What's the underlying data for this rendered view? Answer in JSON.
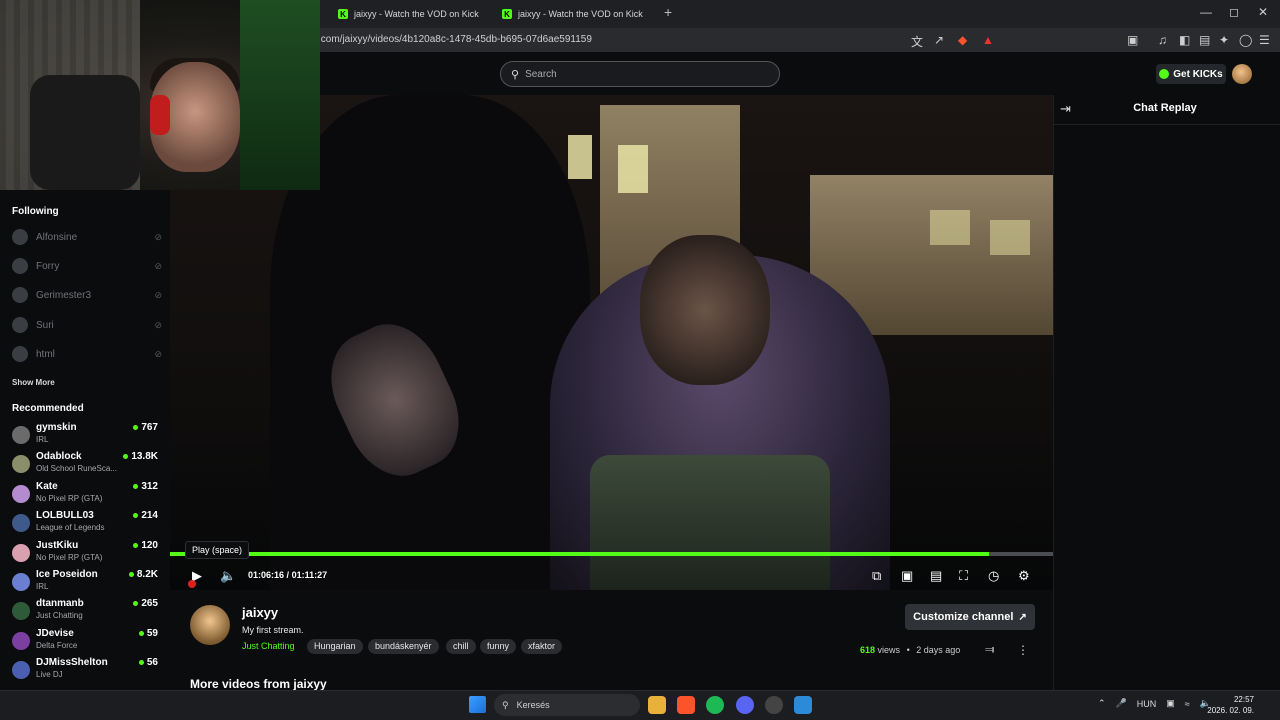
{
  "browser": {
    "tabs": [
      {
        "title": "jaixyy - Watch the VOD on Kick"
      },
      {
        "title": "jaixyy - Watch the VOD on Kick"
      }
    ],
    "new_tab": "+",
    "url": ".com/jaixyy/videos/4b120a8c-1478-45db-b695-07d6ae591159"
  },
  "header": {
    "search_placeholder": "Search",
    "get_kicks": "Get KICKs"
  },
  "sidebar": {
    "following_title": "Following",
    "following": [
      {
        "name": "Alfonsine"
      },
      {
        "name": "Forry"
      },
      {
        "name": "Gerimester3"
      },
      {
        "name": "Suri"
      },
      {
        "name": "html"
      }
    ],
    "show_more": "Show More",
    "recommended_title": "Recommended",
    "recommended": [
      {
        "name": "gymskin",
        "category": "IRL",
        "viewers": "767"
      },
      {
        "name": "Odablock",
        "category": "Old School RuneSca...",
        "viewers": "13.8K"
      },
      {
        "name": "Kate",
        "category": "No Pixel RP (GTA)",
        "viewers": "312"
      },
      {
        "name": "LOLBULL03",
        "category": "League of Legends",
        "viewers": "214"
      },
      {
        "name": "JustKiku",
        "category": "No Pixel RP (GTA)",
        "viewers": "120"
      },
      {
        "name": "Ice Poseidon",
        "category": "IRL",
        "viewers": "8.2K"
      },
      {
        "name": "dtanmanb",
        "category": "Just Chatting",
        "viewers": "265"
      },
      {
        "name": "JDevise",
        "category": "Delta Force",
        "viewers": "59"
      },
      {
        "name": "DJMissShelton",
        "category": "Live DJ",
        "viewers": "56"
      }
    ]
  },
  "player": {
    "tooltip": "Play (space)",
    "current_time": "01:06:16",
    "separator": "/",
    "duration": "01:11:27",
    "progress": 0.928
  },
  "chat": {
    "title": "Chat Replay"
  },
  "channel": {
    "name": "jaixyy",
    "stream_title": "My first stream.",
    "category": "Just Chatting",
    "tags": [
      "Hungarian",
      "bundáskenyér",
      "chill",
      "funny",
      "xfaktor"
    ],
    "customize_label": "Customize channel",
    "views_count": "618",
    "views_label": "views",
    "bullet": "•",
    "age": "2 days ago",
    "more_videos": "More videos from jaixyy"
  },
  "taskbar": {
    "search": "Keresés",
    "lang": "HUN",
    "time": "22:57",
    "date": "2026. 02. 09."
  },
  "colors": {
    "accent": "#53fc18",
    "background": "#0b0c0e"
  }
}
